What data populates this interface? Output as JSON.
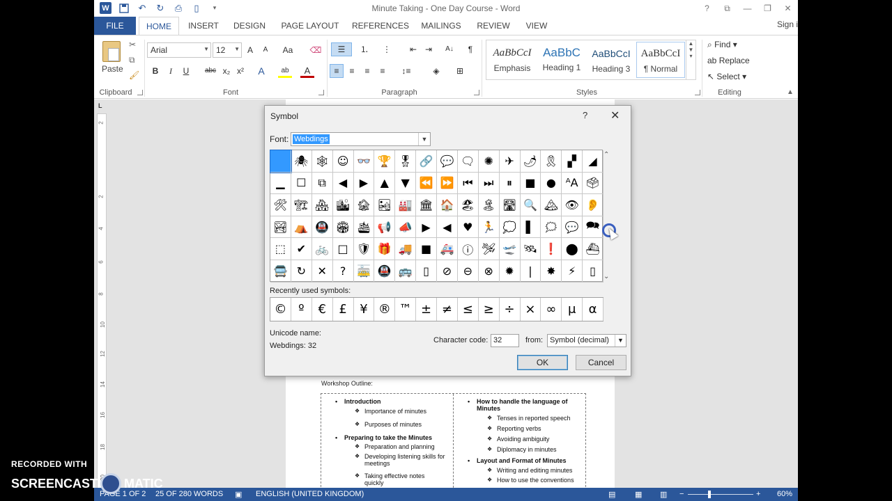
{
  "window": {
    "title": "Minute Taking - One Day Course - Word",
    "controls": [
      "?",
      "⧉",
      "—",
      "❐",
      "✕"
    ]
  },
  "qat": {
    "word_logo": "W",
    "save_icon": "save-icon",
    "undo_icon": "undo-icon",
    "redo_icon": "redo-icon",
    "print_icon": "print-preview-icon",
    "new_icon": "new-document-icon"
  },
  "tabs": [
    "FILE",
    "HOME",
    "INSERT",
    "DESIGN",
    "PAGE LAYOUT",
    "REFERENCES",
    "MAILINGS",
    "REVIEW",
    "VIEW"
  ],
  "signin": "Sign i",
  "ribbon": {
    "clipboard": {
      "paste": "Paste",
      "label": "Clipboard"
    },
    "font": {
      "family": "Arial",
      "size": "12",
      "grow": "A",
      "shrink": "A",
      "case": "Aa",
      "bold": "B",
      "italic": "I",
      "underline": "U",
      "strike": "abc",
      "sub": "x₂",
      "sup": "x²",
      "effects": "A",
      "highlight": "ab",
      "color": "A",
      "label": "Font"
    },
    "paragraph": {
      "sort": "A↓",
      "pilcrow": "¶",
      "label": "Paragraph"
    },
    "styles": {
      "items": [
        {
          "sample": "AaBbCcI",
          "name": "Emphasis"
        },
        {
          "sample": "AaBbC",
          "name": "Heading 1"
        },
        {
          "sample": "AaBbCcI",
          "name": "Heading 3"
        },
        {
          "sample": "AaBbCcI",
          "name": "¶ Normal"
        }
      ],
      "label": "Styles"
    },
    "editing": {
      "find": "Find",
      "replace": "Replace",
      "select": "Select",
      "label": "Editing"
    }
  },
  "ruler": {
    "vertical_numbers": [
      "2",
      "2",
      "4",
      "6",
      "8",
      "10",
      "12",
      "14",
      "16",
      "18",
      "20"
    ]
  },
  "document": {
    "outline_title": "Workshop Outline:",
    "left": [
      {
        "head": "Introduction",
        "subs": [
          "Importance of minutes",
          "Purposes of minutes"
        ]
      },
      {
        "head": "Preparing to take the Minutes",
        "subs": [
          "Preparation and planning",
          "Developing listening skills for meetings",
          "Taking effective notes quickly"
        ]
      }
    ],
    "right": [
      {
        "head": "How to handle the language of Minutes",
        "subs": [
          "Tenses in reported speech",
          "Reporting verbs",
          "Avoiding ambiguity",
          "Diplomacy in minutes"
        ]
      },
      {
        "head": "Layout and Format of Minutes",
        "subs": [
          "Writing and editing minutes",
          "How to use the conventions"
        ]
      }
    ]
  },
  "status": {
    "page": "PAGE 1 OF 2",
    "words": "25 OF 280 WORDS",
    "language": "ENGLISH (UNITED KINGDOM)",
    "zoom": "60%"
  },
  "dialog": {
    "title": "Symbol",
    "help": "?",
    "close": "✕",
    "font_label": "Font:",
    "font_value": "Webdings",
    "symbols": [
      " ",
      "🕷",
      "🕸",
      "☺",
      "👓",
      "🏆",
      "🎖",
      "🔗",
      "💬",
      "🗨",
      "✺",
      "✈",
      "🌶",
      "🎗",
      "▞",
      "◢",
      "▁",
      "☐",
      "⧉",
      "◀",
      "▶",
      "▲",
      "▼",
      "⏪",
      "⏩",
      "⏮",
      "⏭",
      "⏸",
      "■",
      "●",
      "ᴬA",
      "🗳",
      "🛠",
      "🏗",
      "🏘",
      "🏙",
      "🏚",
      "🏜",
      "🏭",
      "🏛",
      "🏠",
      "🏖",
      "🏝",
      "🛣",
      "🔍",
      "🏔",
      "👁",
      "👂",
      "🏞",
      "⛺",
      "🚇",
      "🏟",
      "🛳",
      "📢",
      "📣",
      "▶",
      "◀",
      "♥",
      "🏃",
      "💭",
      "▌",
      "🗯",
      "💬",
      "🗪",
      "⬚",
      "✔",
      "🚲",
      "□",
      "🛡",
      "🎁",
      "🚚",
      "■",
      "🚑",
      "ⓘ",
      "🛩",
      "🛫",
      "🛰",
      "❗",
      "⬤",
      "⛴",
      "🚍",
      "↻",
      "✕",
      "?",
      "🚋",
      "🚇",
      "🚌",
      "▯",
      "⊘",
      "⊖",
      "⊗",
      "✹",
      "|",
      "✸",
      "⚡",
      "▯"
    ],
    "recent_label": "Recently used symbols:",
    "recent": [
      "©",
      "º",
      "€",
      "£",
      "¥",
      "®",
      "™",
      "±",
      "≠",
      "≤",
      "≥",
      "÷",
      "×",
      "∞",
      "μ",
      "α"
    ],
    "unicode_name_label": "Unicode name:",
    "unicode_value": "Webdings: 32",
    "char_code_label": "Character code:",
    "char_code": "32",
    "from_label": "from:",
    "from_value": "Symbol (decimal)",
    "ok": "OK",
    "cancel": "Cancel"
  },
  "watermark": {
    "line1": "RECORDED WITH",
    "line2a": "SCREENCAST",
    "line2b": "MATIC"
  }
}
